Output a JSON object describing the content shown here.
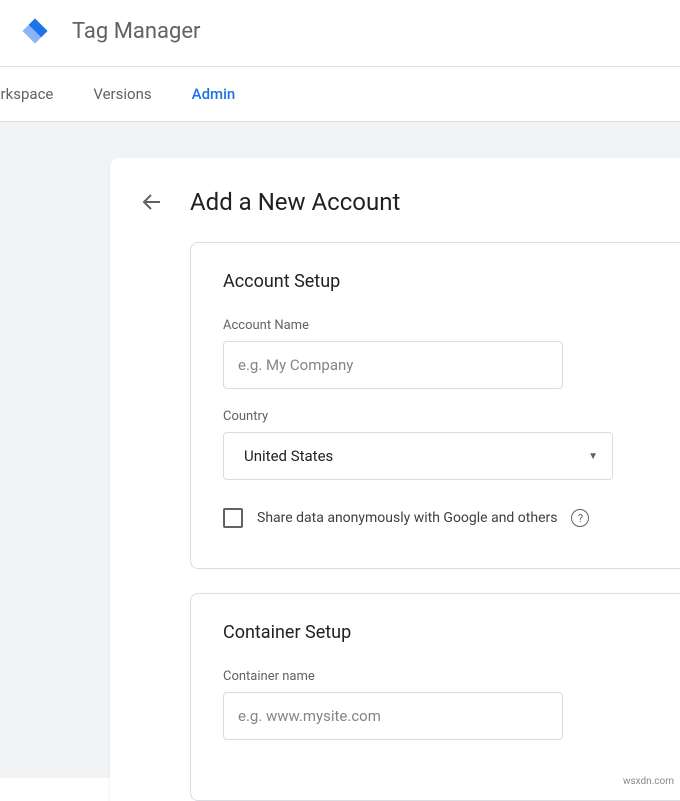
{
  "header": {
    "app_title": "Tag Manager"
  },
  "tabs": {
    "workspace": "orkspace",
    "versions": "Versions",
    "admin": "Admin"
  },
  "panel": {
    "title": "Add a New Account"
  },
  "account_setup": {
    "heading": "Account Setup",
    "name_label": "Account Name",
    "name_placeholder": "e.g. My Company",
    "name_value": "",
    "country_label": "Country",
    "country_value": "United States",
    "share_label": "Share data anonymously with Google and others",
    "share_checked": false
  },
  "container_setup": {
    "heading": "Container Setup",
    "name_label": "Container name",
    "name_placeholder": "e.g. www.mysite.com",
    "name_value": ""
  },
  "watermark": "wsxdn.com"
}
